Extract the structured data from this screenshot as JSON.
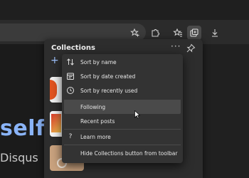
{
  "toolbar": {
    "icons": [
      "add-favorite-icon",
      "extensions-icon",
      "favorites-icon",
      "collections-icon",
      "downloads-icon"
    ]
  },
  "page": {
    "heading_fragment": "self",
    "subtext_fragment": "Disqus"
  },
  "collections_panel": {
    "title": "Collections",
    "more_glyph": "···",
    "add_glyph": "+"
  },
  "sort_menu": {
    "items": [
      {
        "label": "Sort by name",
        "icon": "sort-icon"
      },
      {
        "label": "Sort by date created",
        "icon": "calendar-icon"
      },
      {
        "label": "Sort by recently used",
        "icon": "clock-icon"
      },
      {
        "label": "Following",
        "icon": "",
        "highlighted": true
      },
      {
        "label": "Recent posts",
        "icon": ""
      },
      {
        "label": "Learn more",
        "icon": "help-icon",
        "glyph": "?"
      },
      {
        "label": "Hide Collections button from toolbar",
        "icon": ""
      }
    ]
  },
  "colors": {
    "accent": "#8ab4f8",
    "menu_bg": "#333333",
    "highlight": "#4a4a4a"
  }
}
